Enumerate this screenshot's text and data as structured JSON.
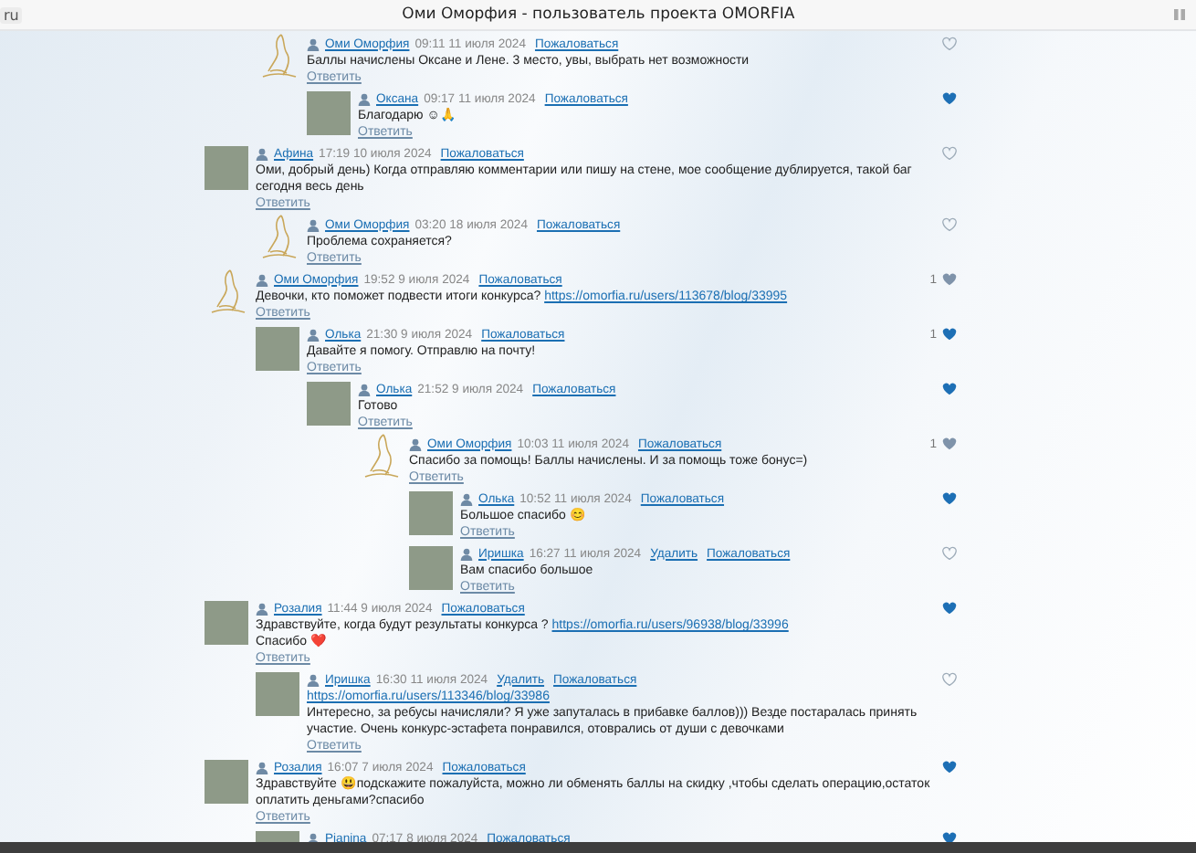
{
  "tab_fragment": "ru",
  "title": "Оми Оморфия - пользователь проекта OMORFIA",
  "comments": [
    {
      "children": [
        {
          "author": "Оми Оморфия",
          "time": "09:11 11 июля 2024",
          "report": "Пожаловаться",
          "kind": "sketch",
          "liked": false,
          "reply": "Ответить",
          "lines": [
            [
              {
                "kind": "text",
                "text": "Баллы начислены Оксане и Лене. 3 место, увы, выбрать нет возможности"
              }
            ]
          ],
          "children": [
            {
              "author": "Оксана",
              "time": "09:17 11 июля 2024",
              "report": "Пожаловаться",
              "kind": "photo",
              "liked": true,
              "reply": "Ответить",
              "lines": [
                [
                  {
                    "kind": "text",
                    "text": "Благодарю ☺🙏"
                  }
                ]
              ]
            }
          ]
        }
      ]
    },
    {
      "author": "Афина",
      "time": "17:19 10 июля 2024",
      "report": "Пожаловаться",
      "kind": "photo",
      "liked": false,
      "reply": "Ответить",
      "lines": [
        [
          {
            "kind": "text",
            "text": "Оми, добрый день) Когда отправляю комментарии или пишу на стене, мое сообщение дублируется, такой баг сегодня весь день"
          }
        ]
      ],
      "children": [
        {
          "author": "Оми Оморфия",
          "time": "03:20 18 июля 2024",
          "report": "Пожаловаться",
          "kind": "sketch",
          "liked": false,
          "reply": "Ответить",
          "lines": [
            [
              {
                "kind": "text",
                "text": "Проблема сохраняется?"
              }
            ]
          ]
        }
      ]
    },
    {
      "author": "Оми Оморфия",
      "time": "19:52 9 июля 2024",
      "report": "Пожаловаться",
      "kind": "sketch",
      "liked": false,
      "likes": "1",
      "reply": "Ответить",
      "lines": [
        [
          {
            "kind": "text",
            "text": "Девочки, кто поможет подвести итоги конкурса? "
          },
          {
            "kind": "link",
            "text": "https://omorfia.ru/users/113678/blog/33995"
          }
        ]
      ],
      "children": [
        {
          "author": "Олька",
          "time": "21:30 9 июля 2024",
          "report": "Пожаловаться",
          "kind": "photo",
          "liked": true,
          "likes": "1",
          "reply": "Ответить",
          "lines": [
            [
              {
                "kind": "text",
                "text": "Давайте я помогу. Отправлю на почту!"
              }
            ]
          ],
          "children": [
            {
              "author": "Олька",
              "time": "21:52 9 июля 2024",
              "report": "Пожаловаться",
              "kind": "photo",
              "liked": true,
              "reply": "Ответить",
              "lines": [
                [
                  {
                    "kind": "text",
                    "text": "Готово"
                  }
                ]
              ],
              "children": [
                {
                  "author": "Оми Оморфия",
                  "time": "10:03 11 июля 2024",
                  "report": "Пожаловаться",
                  "kind": "sketch",
                  "liked": false,
                  "likes": "1",
                  "reply": "Ответить",
                  "lines": [
                    [
                      {
                        "kind": "text",
                        "text": "Спасибо за помощь! Баллы начислены. И за помощь тоже бонус=)"
                      }
                    ]
                  ],
                  "children": [
                    {
                      "author": "Олька",
                      "time": "10:52 11 июля 2024",
                      "report": "Пожаловаться",
                      "kind": "photo",
                      "liked": true,
                      "reply": "Ответить",
                      "lines": [
                        [
                          {
                            "kind": "text",
                            "text": "Большое спасибо 😊"
                          }
                        ]
                      ]
                    },
                    {
                      "author": "Иришка",
                      "time": "16:27 11 июля 2024",
                      "delete": "Удалить",
                      "report": "Пожаловаться",
                      "kind": "photo",
                      "liked": false,
                      "reply": "Ответить",
                      "lines": [
                        [
                          {
                            "kind": "text",
                            "text": "Вам спасибо большое"
                          }
                        ]
                      ]
                    }
                  ]
                }
              ]
            }
          ]
        }
      ]
    },
    {
      "author": "Розалия",
      "time": "11:44 9 июля 2024",
      "report": "Пожаловаться",
      "kind": "photo",
      "liked": true,
      "reply": "Ответить",
      "lines": [
        [
          {
            "kind": "text",
            "text": "Здравствуйте, когда будут результаты конкурса ? "
          },
          {
            "kind": "link",
            "text": "https://omorfia.ru/users/96938/blog/33996"
          }
        ],
        [
          {
            "kind": "text",
            "text": "Спасибо ❤️"
          }
        ]
      ],
      "children": [
        {
          "author": "Иришка",
          "time": "16:30 11 июля 2024",
          "delete": "Удалить",
          "report": "Пожаловаться",
          "kind": "photo",
          "liked": false,
          "reply": "Ответить",
          "lines": [
            [
              {
                "kind": "link",
                "text": "https://omorfia.ru/users/113346/blog/33986"
              }
            ],
            [
              {
                "kind": "text",
                "text": "Интересно, за ребусы начисляли? Я уже запуталась в прибавке баллов))) Везде постаралась принять участие. Очень конкурс-эстафета понравился, отоврались от души с девочками"
              }
            ]
          ]
        }
      ]
    },
    {
      "author": "Розалия",
      "time": "16:07 7 июля 2024",
      "report": "Пожаловаться",
      "kind": "photo",
      "liked": true,
      "reply": "Ответить",
      "lines": [
        [
          {
            "kind": "text",
            "text": "Здравствуйте 😃подскажите пожалуйста, можно ли обменять баллы на скидку ,чтобы сделать операцию,остаток оплатить деньгами?спасибо"
          }
        ]
      ],
      "children": [
        {
          "author": "Pianina",
          "time": "07:17 8 июля 2024",
          "report": "Пожаловаться",
          "kind": "photo",
          "liked": true
        }
      ]
    }
  ]
}
